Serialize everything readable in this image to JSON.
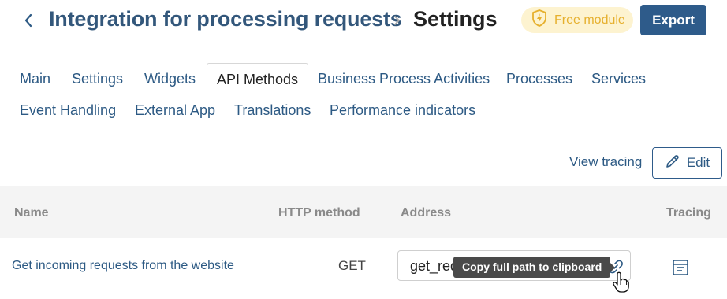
{
  "header": {
    "back_icon": "chevron-left-icon",
    "title": "Integration for processing requests",
    "separator_icon": "chevron-right-icon",
    "subtitle": "Settings",
    "badge_label": "Free module",
    "badge_icon": "lightning-shield-icon",
    "export_label": "Export"
  },
  "tabs": [
    {
      "label": "Main"
    },
    {
      "label": "Settings"
    },
    {
      "label": "Widgets"
    },
    {
      "label": "API Methods",
      "active": true
    },
    {
      "label": "Business Process Activities"
    },
    {
      "label": "Processes"
    },
    {
      "label": "Services"
    },
    {
      "label": "Event Handling"
    },
    {
      "label": "External App"
    },
    {
      "label": "Translations"
    },
    {
      "label": "Performance indicators"
    }
  ],
  "toolbar": {
    "view_tracing_label": "View tracing",
    "edit_label": "Edit",
    "edit_icon": "pencil-icon"
  },
  "table": {
    "columns": {
      "name": "Name",
      "http_method": "HTTP method",
      "address": "Address",
      "tracing": "Tracing"
    },
    "rows": [
      {
        "name": "Get incoming requests from the website",
        "http_method": "GET",
        "address": "get_requests",
        "copy_icon": "link-icon",
        "tracing_icon": "tracing-log-icon"
      }
    ]
  },
  "tooltip": {
    "text": "Copy full path to clipboard"
  },
  "colors": {
    "accent": "#2e5b8a",
    "link": "#2d5a84",
    "badge_bg": "#fdf3d0",
    "badge_text": "#e6b02e",
    "header_bg": "#f4f4f4"
  }
}
